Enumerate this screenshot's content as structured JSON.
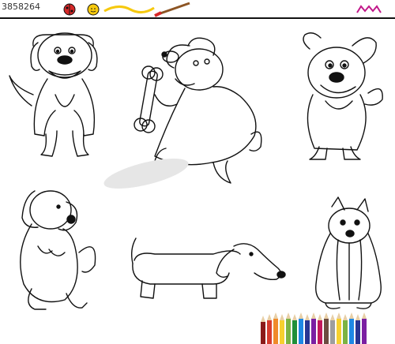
{
  "header": {
    "image_id": "3858264",
    "brand_mark": "m"
  },
  "drawings": {
    "dog_1": "sitting-shaggy-dog",
    "dog_2": "dog-with-bone",
    "dog_3": "spotted-dog",
    "dog_4": "dog-begging",
    "dog_5": "dachshund",
    "dog_6": "yorkshire-terrier"
  },
  "colors": {
    "ink": "#111111",
    "bar": "#111111",
    "accent_magenta": "#c2188a",
    "pencils": [
      "#8b1a1a",
      "#d63b2f",
      "#f08a2a",
      "#f6d02f",
      "#7cb342",
      "#1f8f3a",
      "#1e88e5",
      "#283593",
      "#7b1fa2",
      "#c2185b",
      "#6d4c41",
      "#9e9e9e"
    ]
  }
}
